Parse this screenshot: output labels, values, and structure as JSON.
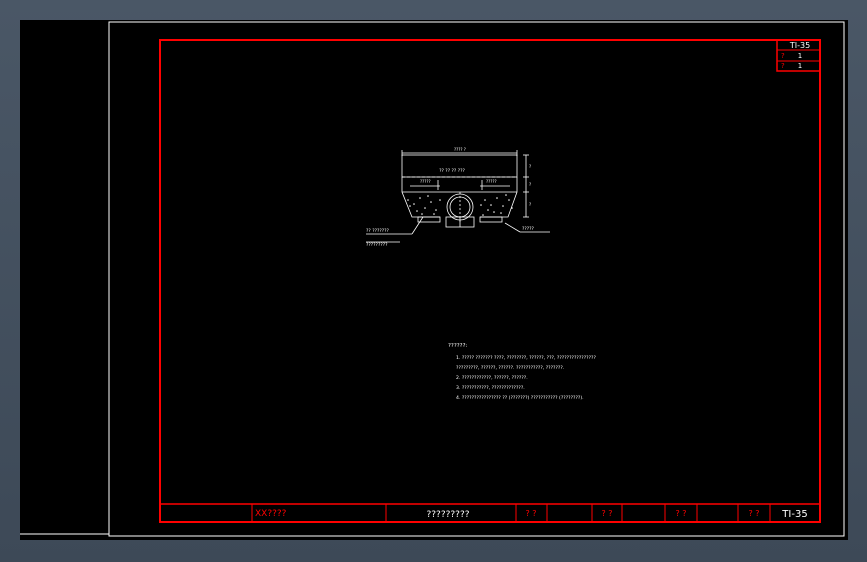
{
  "title_block": {
    "sheet_code": "TI-35",
    "field_prefix_1": "?",
    "field_value_1": "1",
    "field_prefix_2": "?",
    "field_value_2": "1",
    "company": "XX????",
    "drawing_name": "?????????",
    "label_1": "? ?",
    "label_2": "? ?",
    "label_3": "? ?",
    "label_4": "? ?",
    "drawing_number": "TI-35"
  },
  "colors": {
    "frame_red": "#ff0000",
    "drawing_white": "#ffffff",
    "background": "#000000"
  },
  "detail": {
    "top_dim_label": "???? ?",
    "inner_label": "?? ?? ?? ???",
    "dim_left": "?????",
    "dim_right": "?????",
    "callout_left_1": "?? ???????",
    "callout_left_2": "?????????",
    "callout_right": "?????",
    "dim_side_1": "?",
    "dim_side_2": "?",
    "dim_side_3": "?"
  },
  "notes": {
    "heading": "??????:",
    "line_1": "1. ????? ??????? ????, ????????, ??????, ???, ????????????????",
    "line_2": "   ?????????, ??????, ??????. ???????????, ???????.",
    "line_3": "2. ????????????, ??????, ??????.",
    "line_4": "3. ???????????, ?????????????.",
    "line_5": "4. ???????????????? ?? (???????) ??????????? (????????)."
  }
}
